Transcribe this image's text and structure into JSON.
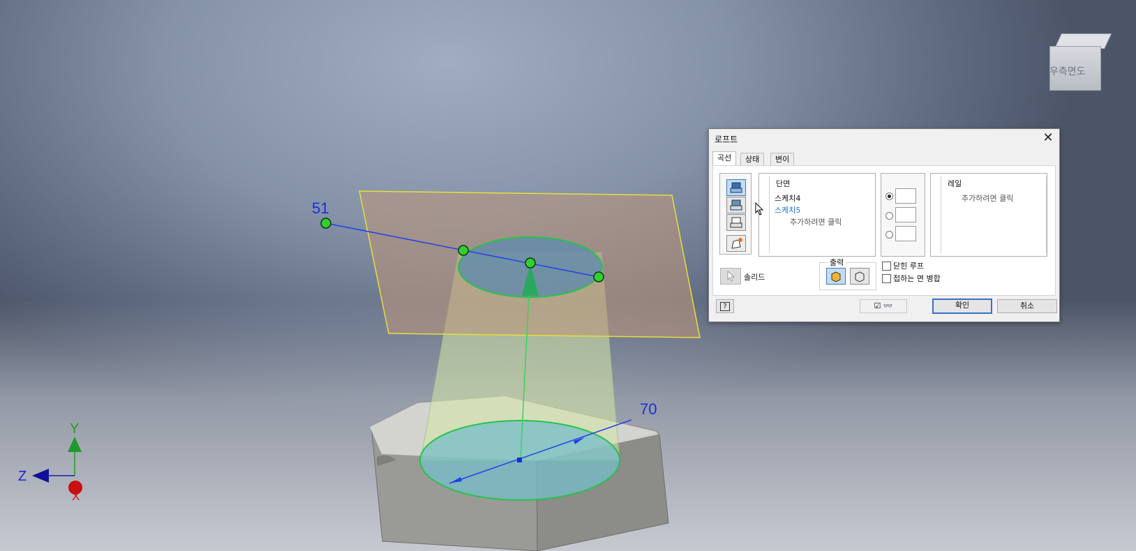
{
  "viewport": {
    "dimension_top": "51",
    "dimension_bottom": "70",
    "axis_y": "Y",
    "axis_z": "Z",
    "axis_x": "X",
    "viewcube_label": "우측면도"
  },
  "dialog": {
    "title": "로프트",
    "tabs": [
      "곡선",
      "상태",
      "변이"
    ],
    "sections_header": "단면",
    "sections_items": [
      "스케치4",
      "스케치5"
    ],
    "sections_hint": "추가하려면 클릭",
    "rails_header": "레일",
    "rails_hint": "추가하려면 클릭",
    "output_label": "출력",
    "solid_label": "솔리드",
    "closed_loop_label": "닫힌 루프",
    "merge_faces_label": "접하는 면 병합",
    "ok_label": "확인",
    "cancel_label": "취소",
    "help_label": "?"
  },
  "colors": {
    "accent": "#3572c6",
    "dimension_blue": "#1530d8",
    "point_green": "#2fd12f"
  }
}
